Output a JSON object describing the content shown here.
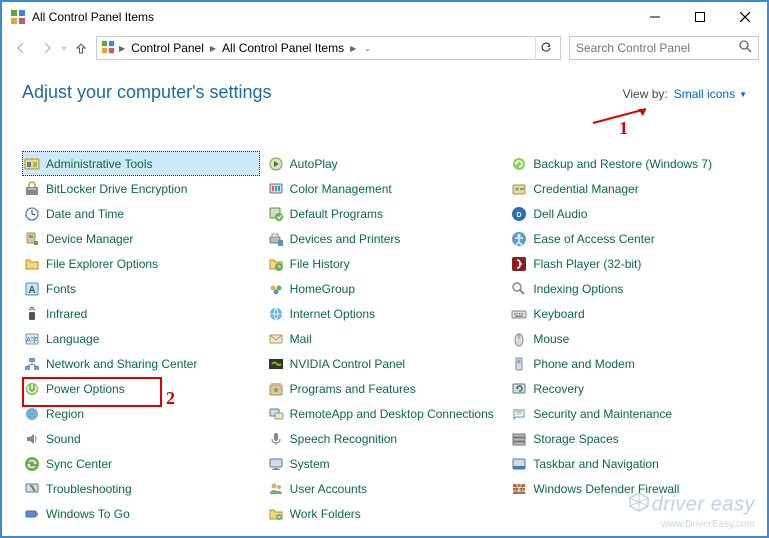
{
  "window": {
    "title": "All Control Panel Items"
  },
  "breadcrumbs": {
    "a": "Control Panel",
    "b": "All Control Panel Items"
  },
  "search": {
    "placeholder": "Search Control Panel"
  },
  "header": {
    "text": "Adjust your computer's settings"
  },
  "viewby": {
    "label": "View by:",
    "value": "Small icons"
  },
  "items": {
    "c1": "Administrative Tools",
    "c2": "AutoPlay",
    "c3": "Backup and Restore (Windows 7)",
    "c4": "BitLocker Drive Encryption",
    "c5": "Color Management",
    "c6": "Credential Manager",
    "c7": "Date and Time",
    "c8": "Default Programs",
    "c9": "Dell Audio",
    "c10": "Device Manager",
    "c11": "Devices and Printers",
    "c12": "Ease of Access Center",
    "c13": "File Explorer Options",
    "c14": "File History",
    "c15": "Flash Player (32-bit)",
    "c16": "Fonts",
    "c17": "HomeGroup",
    "c18": "Indexing Options",
    "c19": "Infrared",
    "c20": "Internet Options",
    "c21": "Keyboard",
    "c22": "Language",
    "c23": "Mail",
    "c24": "Mouse",
    "c25": "Network and Sharing Center",
    "c26": "NVIDIA Control Panel",
    "c27": "Phone and Modem",
    "c28": "Power Options",
    "c29": "Programs and Features",
    "c30": "Recovery",
    "c31": "Region",
    "c32": "RemoteApp and Desktop Connections",
    "c33": "Security and Maintenance",
    "c34": "Sound",
    "c35": "Speech Recognition",
    "c36": "Storage Spaces",
    "c37": "Sync Center",
    "c38": "System",
    "c39": "Taskbar and Navigation",
    "c40": "Troubleshooting",
    "c41": "User Accounts",
    "c42": "Windows Defender Firewall",
    "c43": "Windows To Go",
    "c44": "Work Folders"
  },
  "annotations": {
    "n1": "1",
    "n2": "2"
  },
  "watermark": {
    "brand": "driver easy",
    "url": "www.DriverEasy.com"
  }
}
